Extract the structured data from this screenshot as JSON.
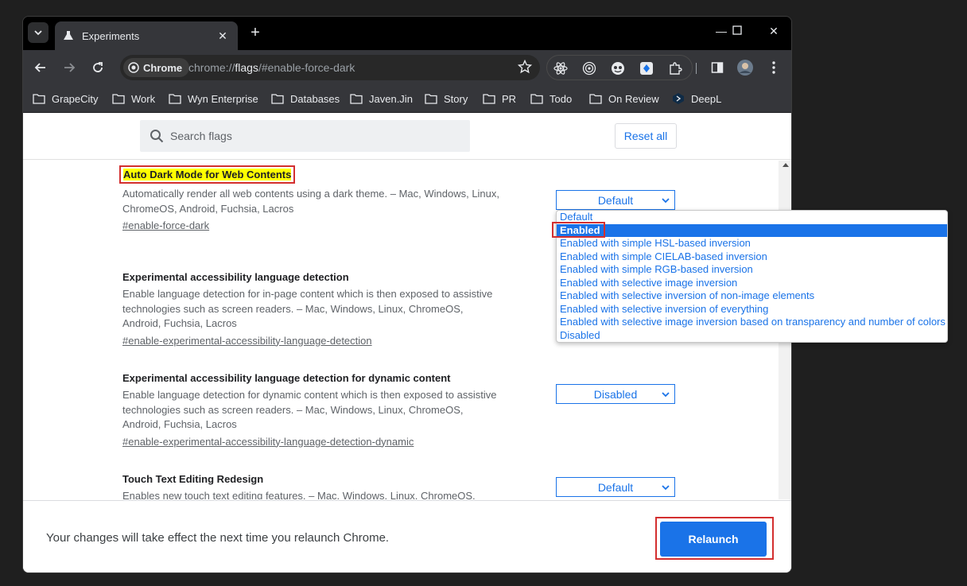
{
  "tab": {
    "title": "Experiments"
  },
  "omnibox": {
    "chip": "Chrome",
    "url_scheme": "chrome://",
    "url_host": "flags",
    "url_path": "/#enable-force-dark"
  },
  "bookmarks": [
    "GrapeCity",
    "Work",
    "Wyn Enterprise",
    "Databases",
    "Javen.Jin",
    "Story",
    "PR",
    "Todo",
    "On Review",
    "DeepL"
  ],
  "header": {
    "search_placeholder": "Search flags",
    "reset_label": "Reset all"
  },
  "flags": [
    {
      "title": "Auto Dark Mode for Web Contents",
      "desc": "Automatically render all web contents using a dark theme. – Mac, Windows, Linux, ChromeOS, Android, Fuchsia, Lacros",
      "link": "#enable-force-dark",
      "value": "Default"
    },
    {
      "title": "Experimental accessibility language detection",
      "desc": "Enable language detection for in-page content which is then exposed to assistive technologies such as screen readers. – Mac, Windows, Linux, ChromeOS, Android, Fuchsia, Lacros",
      "link": "#enable-experimental-accessibility-language-detection",
      "value": ""
    },
    {
      "title": "Experimental accessibility language detection for dynamic content",
      "desc": "Enable language detection for dynamic content which is then exposed to assistive technologies such as screen readers. – Mac, Windows, Linux, ChromeOS, Android, Fuchsia, Lacros",
      "link": "#enable-experimental-accessibility-language-detection-dynamic",
      "value": "Disabled"
    },
    {
      "title": "Touch Text Editing Redesign",
      "desc": "Enables new touch text editing features. – Mac, Windows, Linux, ChromeOS, Android, Fuchsia, Lacros",
      "link": "",
      "value": "Default"
    }
  ],
  "dropdown_options": [
    "Default",
    "Enabled",
    "Enabled with simple HSL-based inversion",
    "Enabled with simple CIELAB-based inversion",
    "Enabled with simple RGB-based inversion",
    "Enabled with selective image inversion",
    "Enabled with selective inversion of non-image elements",
    "Enabled with selective inversion of everything",
    "Enabled with selective image inversion based on transparency and number of colors",
    "Disabled"
  ],
  "dropdown_selected": "Enabled",
  "footer": {
    "message": "Your changes will take effect the next time you relaunch Chrome.",
    "relaunch_label": "Relaunch"
  },
  "colors": {
    "accent": "#1a73e8",
    "highlight": "#ffff00",
    "annotation": "#d32f2f"
  }
}
